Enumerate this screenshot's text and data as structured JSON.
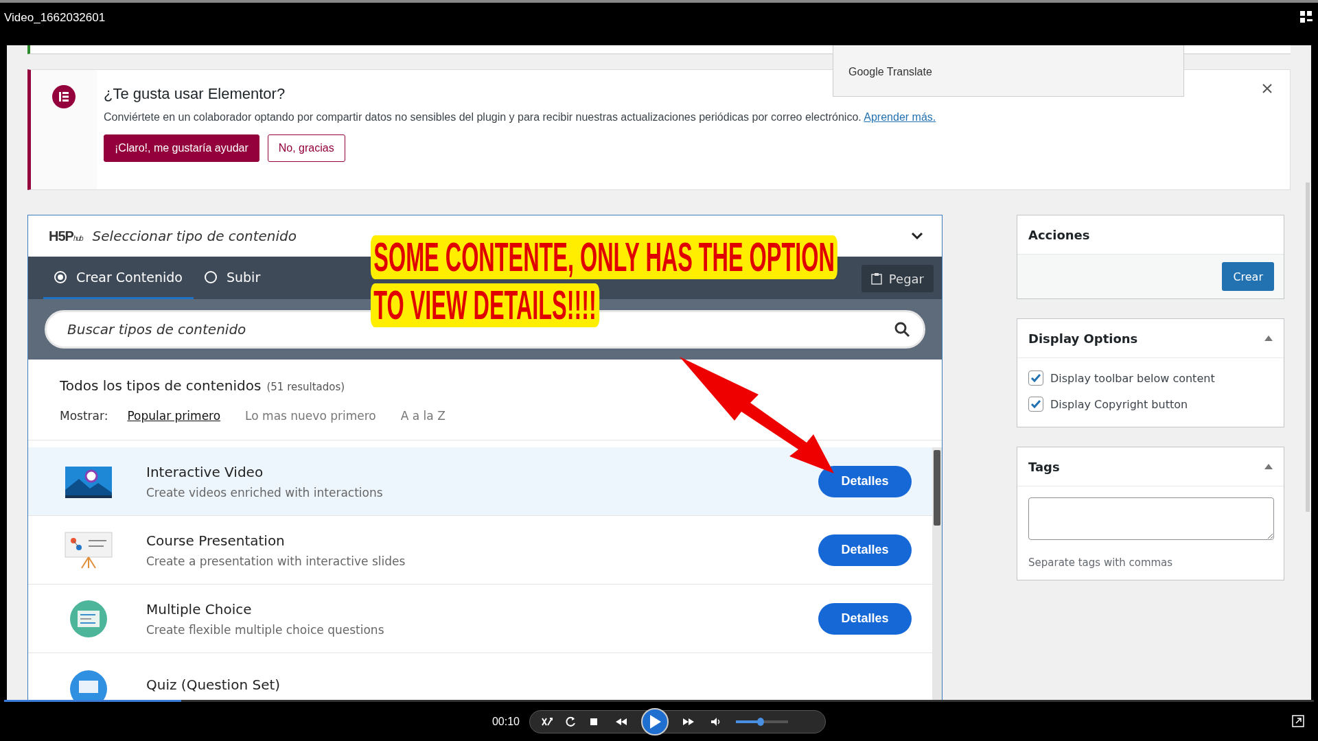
{
  "player": {
    "title": "Video_1662032601",
    "time": "00:10",
    "progress": {
      "level": 0.135
    },
    "volume": {
      "level": 0.48
    }
  },
  "translate_popup": {
    "label": "Google Translate"
  },
  "notice": {
    "title": "¿Te gusta usar Elementor?",
    "text": "Conviértete en un colaborador optando por compartir datos no sensibles del plugin y para recibir nuestras actualizaciones periódicas por correo electrónico.",
    "link": "Aprender más.",
    "buttons": [
      {
        "label": "¡Claro!, me gustaría ayudar",
        "kind": "primary"
      },
      {
        "label": "No, gracias",
        "kind": "secondary"
      }
    ]
  },
  "hub": {
    "logo": "H5P",
    "logo_sub": "hub",
    "title": "Seleccionar tipo de contenido",
    "expanded": true,
    "tabs": [
      {
        "label": "Crear Contenido",
        "selected": true
      },
      {
        "label": "Subir",
        "selected": false
      }
    ],
    "paste": "Pegar",
    "search": {
      "placeholder": "Buscar tipos de contenido"
    },
    "heading": "Todos los tipos de contenidos",
    "count": "(51 resultados)",
    "sort_label": "Mostrar:",
    "sort_options": [
      {
        "label": "Popular primero",
        "selected": true
      },
      {
        "label": "Lo mas nuevo primero",
        "selected": false
      },
      {
        "label": "A a la Z",
        "selected": false
      }
    ],
    "items": [
      {
        "kind": "video",
        "title": "Interactive Video",
        "description": "Create videos enriched with interactions",
        "button": "Detalles",
        "selected": true
      },
      {
        "kind": "presentation",
        "title": "Course Presentation",
        "description": "Create a presentation with interactive slides",
        "button": "Detalles",
        "selected": false
      },
      {
        "kind": "choice",
        "title": "Multiple Choice",
        "description": "Create flexible multiple choice questions",
        "button": "Detalles",
        "selected": false
      },
      {
        "kind": "quiz",
        "title": "Quiz (Question Set)",
        "selected": false
      }
    ]
  },
  "annotation": {
    "lines": [
      "SOME CONTENTE, ONLY HAS THE OPTION",
      "TO VIEW DETAILS!!!!"
    ]
  },
  "sidebar": {
    "actions": {
      "title": "Acciones",
      "button": "Crear"
    },
    "display_options": {
      "title": "Display Options",
      "expanded": true,
      "options": [
        {
          "label": "Display toolbar below content",
          "checked": true
        },
        {
          "label": "Display Copyright button",
          "checked": true
        }
      ]
    },
    "tags": {
      "title": "Tags",
      "expanded": true,
      "hint": "Separate tags with commas"
    }
  }
}
